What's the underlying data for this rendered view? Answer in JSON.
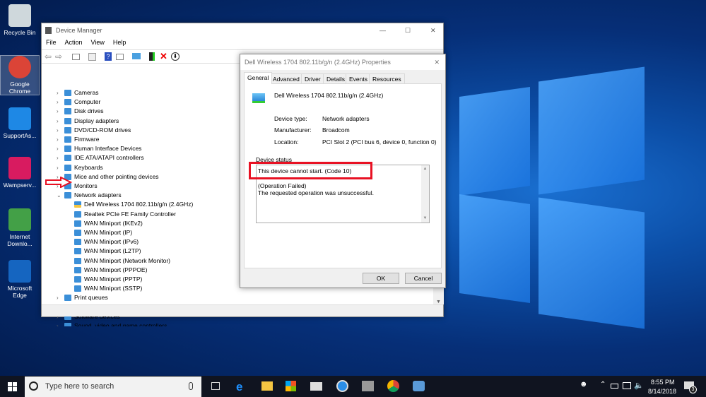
{
  "desktop": {
    "icons": [
      {
        "label": "Recycle Bin",
        "icon": "recycle-bin-icon"
      },
      {
        "label": "Google Chrome",
        "icon": "chrome-icon"
      },
      {
        "label": "SupportAs...",
        "icon": "supportassist-icon"
      },
      {
        "label": "Wampserv...",
        "icon": "wampserver-icon"
      },
      {
        "label": "Internet Downlo...",
        "icon": "idm-icon"
      },
      {
        "label": "Microsoft Edge",
        "icon": "edge-icon"
      }
    ]
  },
  "device_manager": {
    "title": "Device Manager",
    "menu": [
      "File",
      "Action",
      "View",
      "Help"
    ],
    "tree": [
      {
        "label": "Cameras",
        "level": 0,
        "expanded": false
      },
      {
        "label": "Computer",
        "level": 0,
        "expanded": false
      },
      {
        "label": "Disk drives",
        "level": 0,
        "expanded": false
      },
      {
        "label": "Display adapters",
        "level": 0,
        "expanded": false
      },
      {
        "label": "DVD/CD-ROM drives",
        "level": 0,
        "expanded": false
      },
      {
        "label": "Firmware",
        "level": 0,
        "expanded": false
      },
      {
        "label": "Human Interface Devices",
        "level": 0,
        "expanded": false
      },
      {
        "label": "IDE ATA/ATAPI controllers",
        "level": 0,
        "expanded": false
      },
      {
        "label": "Keyboards",
        "level": 0,
        "expanded": false
      },
      {
        "label": "Mice and other pointing devices",
        "level": 0,
        "expanded": false
      },
      {
        "label": "Monitors",
        "level": 0,
        "expanded": false
      },
      {
        "label": "Network adapters",
        "level": 0,
        "expanded": true
      },
      {
        "label": "Dell Wireless 1704 802.11b/g/n (2.4GHz)",
        "level": 1,
        "warning": true
      },
      {
        "label": "Realtek PCIe FE Family Controller",
        "level": 1
      },
      {
        "label": "WAN Miniport (IKEv2)",
        "level": 1
      },
      {
        "label": "WAN Miniport (IP)",
        "level": 1
      },
      {
        "label": "WAN Miniport (IPv6)",
        "level": 1
      },
      {
        "label": "WAN Miniport (L2TP)",
        "level": 1
      },
      {
        "label": "WAN Miniport (Network Monitor)",
        "level": 1
      },
      {
        "label": "WAN Miniport (PPPOE)",
        "level": 1
      },
      {
        "label": "WAN Miniport (PPTP)",
        "level": 1
      },
      {
        "label": "WAN Miniport (SSTP)",
        "level": 1
      },
      {
        "label": "Print queues",
        "level": 0,
        "expanded": false
      },
      {
        "label": "Processors",
        "level": 0,
        "expanded": false
      },
      {
        "label": "Software devices",
        "level": 0,
        "expanded": false
      },
      {
        "label": "Sound, video and game controllers",
        "level": 0,
        "expanded": false
      }
    ]
  },
  "properties": {
    "title": "Dell Wireless 1704 802.11b/g/n (2.4GHz) Properties",
    "tabs": [
      "General",
      "Advanced",
      "Driver",
      "Details",
      "Events",
      "Resources"
    ],
    "active_tab": "General",
    "device_name": "Dell Wireless 1704 802.11b/g/n (2.4GHz)",
    "device_type_label": "Device type:",
    "device_type": "Network adapters",
    "manufacturer_label": "Manufacturer:",
    "manufacturer": "Broadcom",
    "location_label": "Location:",
    "location": "PCI Slot 2 (PCI bus 6, device 0, function 0)",
    "status_label": "Device status",
    "status_line1": "This device cannot start. (Code 10)",
    "status_line2": "(Operation Failed)",
    "status_line3": "The requested operation was unsuccessful.",
    "ok": "OK",
    "cancel": "Cancel"
  },
  "taskbar": {
    "search_placeholder": "Type here to search",
    "time": "8:55 PM",
    "date": "8/14/2018",
    "notifications": "3"
  },
  "colors": {
    "highlight": "#e81123",
    "accent": "#0078d7"
  }
}
